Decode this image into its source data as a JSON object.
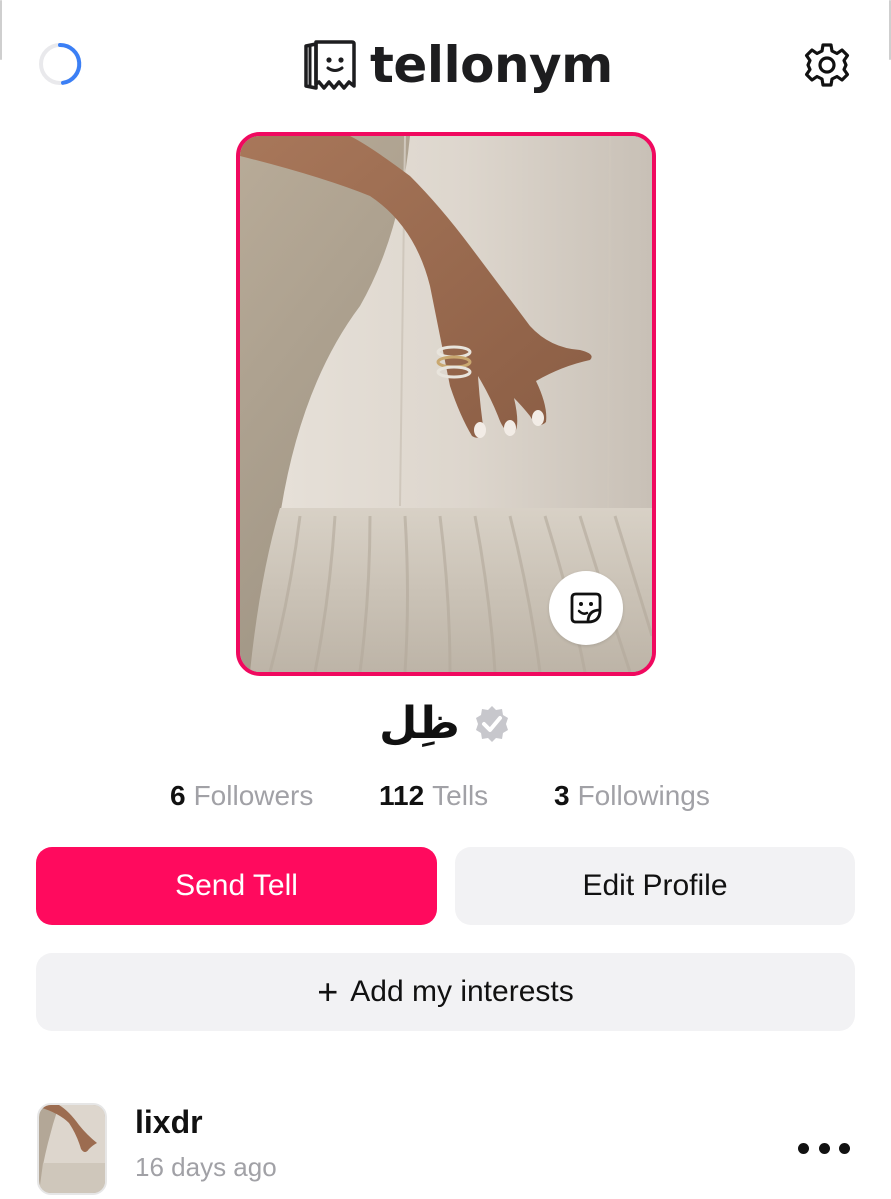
{
  "header": {
    "brand": "tellonym",
    "icons": {
      "loading": "loading-spinner-icon",
      "logo": "tellonym-logo-icon",
      "settings": "gear-icon"
    }
  },
  "profile": {
    "name": "ظِل",
    "verified": true,
    "photo_border_color": "#f0095f",
    "sticker_icon": "sticker-icon",
    "stats": {
      "followers": {
        "count": "6",
        "label": "Followers"
      },
      "tells": {
        "count": "112",
        "label": "Tells"
      },
      "followings": {
        "count": "3",
        "label": "Followings"
      }
    }
  },
  "actions": {
    "send_tell": "Send Tell",
    "edit_profile": "Edit Profile",
    "add_interests_plus": "+",
    "add_interests": "Add my interests"
  },
  "colors": {
    "accent": "#ff0a5e",
    "secondary_button": "#f2f2f4",
    "muted_text": "#a1a1a6",
    "spinner": "#3b7ff5"
  },
  "feed": {
    "posts": [
      {
        "username": "lixdr",
        "time": "16 days ago",
        "more_icon": "more-horizontal-icon"
      }
    ]
  }
}
